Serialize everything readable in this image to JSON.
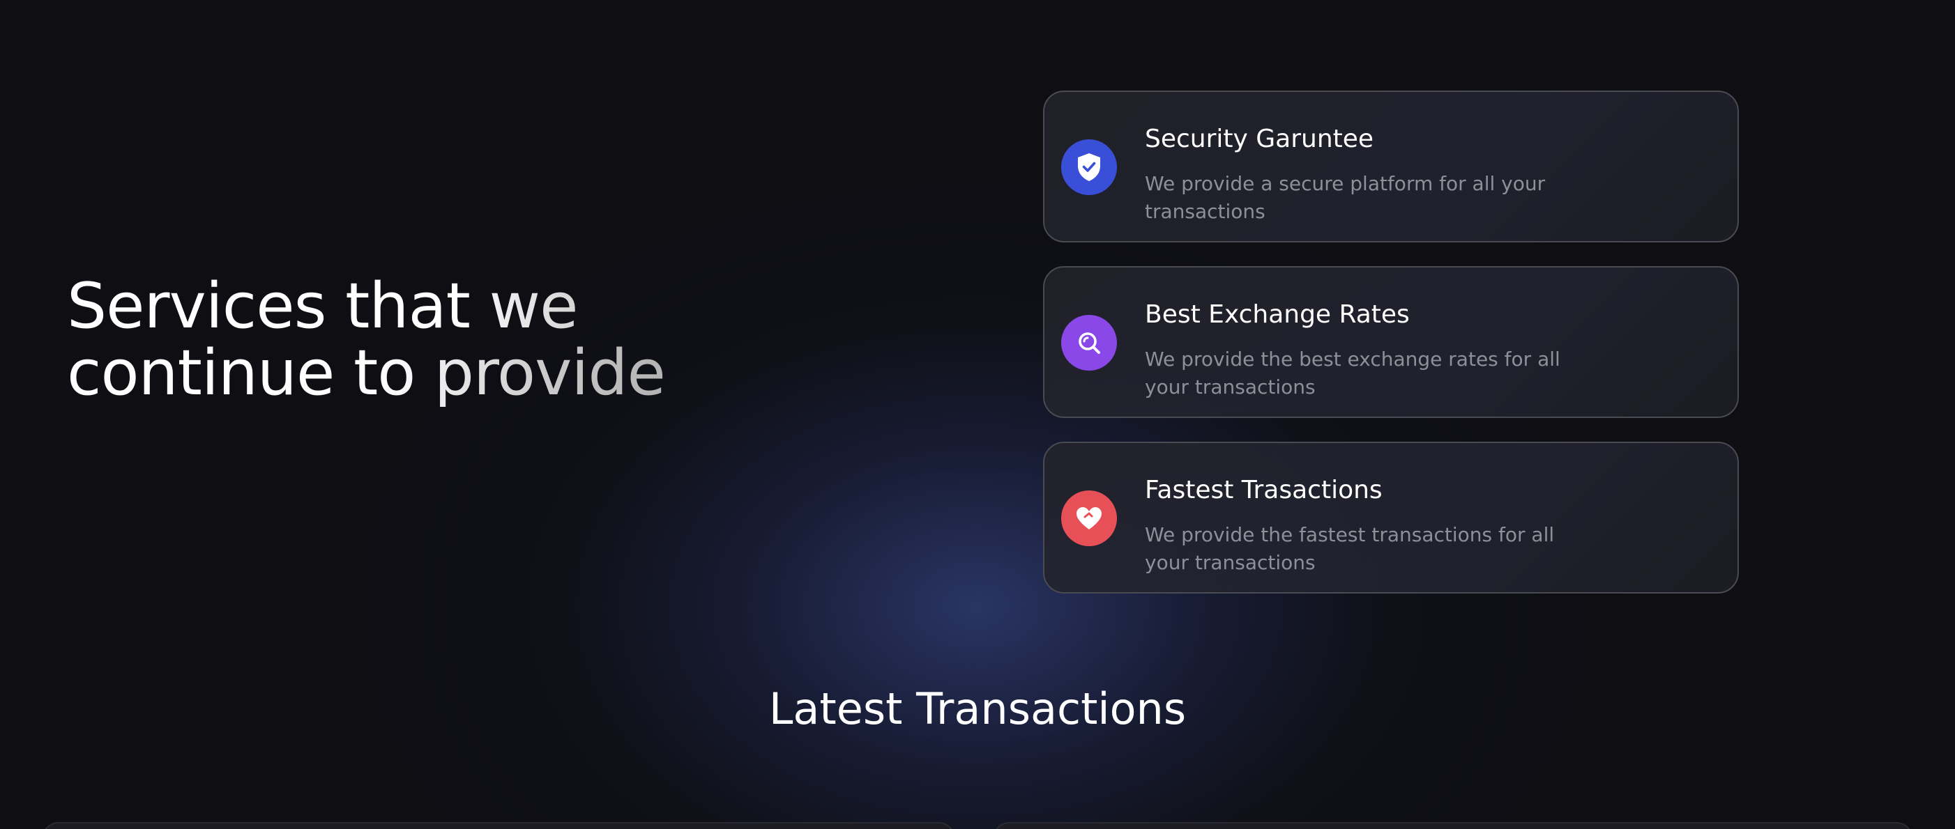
{
  "hero": {
    "line1": "Services that we",
    "line2": "continue to provide"
  },
  "services": [
    {
      "title": "Security Garuntee",
      "description": "We provide a secure platform for all your transactions",
      "icon": "shield-check-icon",
      "icon_color": "#3a4fd8"
    },
    {
      "title": "Best Exchange Rates",
      "description": "We provide the best exchange rates for all your transactions",
      "icon": "search-icon",
      "icon_color": "#8a48e8"
    },
    {
      "title": "Fastest Trasactions",
      "description": "We provide the fastest transactions for all your transactions",
      "icon": "heart-icon",
      "icon_color": "#e85058"
    }
  ],
  "latest": {
    "title": "Latest Transactions"
  }
}
